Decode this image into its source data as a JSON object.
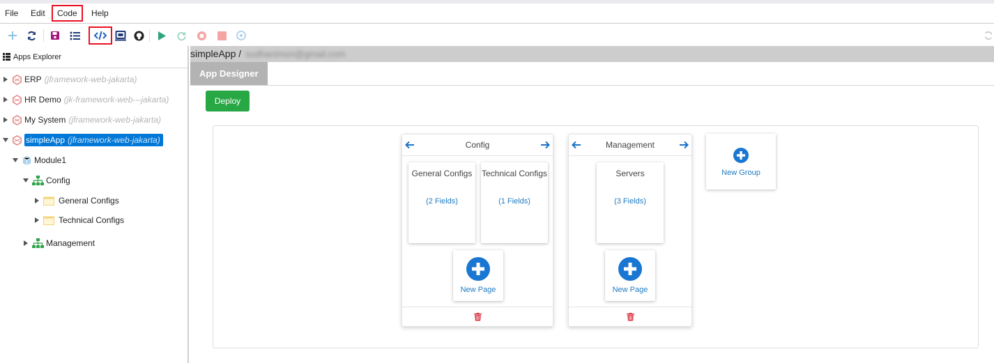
{
  "menu": [
    "File",
    "Edit",
    "Code",
    "Help"
  ],
  "sidebar": {
    "title": "Apps Explorer",
    "apps": [
      {
        "name": "ERP",
        "source": "(jframework-web-jakarta)"
      },
      {
        "name": "HR Demo",
        "source": "(jk-framework-web---jakarta)"
      },
      {
        "name": "My System",
        "source": "(jframework-web-jakarta)"
      },
      {
        "name": "simpleApp",
        "source": "(jframework-web-jakarta)"
      }
    ],
    "module": "Module1",
    "groups": [
      "Config",
      "Management"
    ],
    "pages": [
      "General Configs",
      "Technical Configs"
    ]
  },
  "breadcrumb": {
    "app": "simpleApp /",
    "user_blurred": "sudhanimon@gmail.com"
  },
  "tab": "App Designer",
  "deploy_label": "Deploy",
  "designer": {
    "groups": [
      {
        "name": "Config",
        "pages": [
          {
            "title": "General Configs",
            "fields": "(2 Fields)"
          },
          {
            "title": "Technical Configs",
            "fields": "(1 Fields)"
          }
        ]
      },
      {
        "name": "Management",
        "pages": [
          {
            "title": "Servers",
            "fields": "(3 Fields)"
          }
        ]
      }
    ],
    "new_page_label": "New Page",
    "new_group_label": "New Group"
  },
  "colors": {
    "accent": "#0078d7",
    "deploy": "#28a745",
    "highlight": "#e81123",
    "delete": "#dc3545"
  },
  "icons": [
    "plus-icon",
    "refresh-icon",
    "save-icon",
    "list-icon",
    "code-icon",
    "monitor-icon",
    "github-icon",
    "play-icon",
    "redo-icon",
    "stop-circle-icon",
    "stop-square-icon",
    "settings-icon",
    "sync-icon"
  ]
}
